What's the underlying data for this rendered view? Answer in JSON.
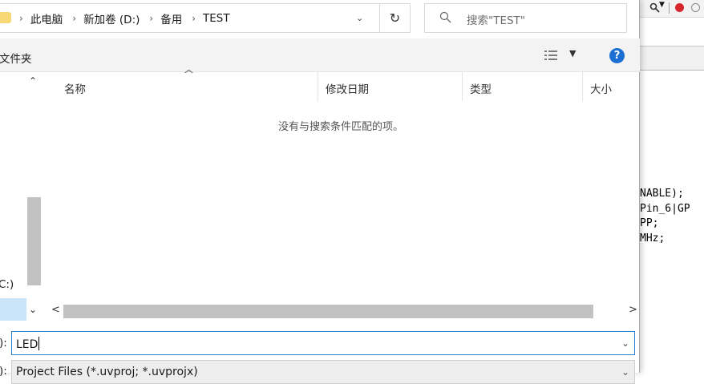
{
  "address_bar": {
    "separator": "›",
    "crumbs": [
      "此电脑",
      "新加卷 (D:)",
      "备用",
      "TEST"
    ],
    "dropdown_glyph": "⌄",
    "refresh_glyph": "↻"
  },
  "search": {
    "placeholder": "搜索\"TEST\"",
    "icon": "search-icon"
  },
  "command_bar": {
    "new_folder": "文件夹",
    "help_glyph": "?"
  },
  "nav_pane": {
    "visible_item": "C:)",
    "scroll_up": "⌃",
    "scroll_down": "⌄"
  },
  "file_list": {
    "sort_indicator": "^",
    "columns": [
      "名称",
      "修改日期",
      "类型",
      "大小"
    ],
    "empty_message": "没有与搜索条件匹配的项。",
    "scroll_left": "<",
    "scroll_right": ">"
  },
  "bottom": {
    "filename_label": "):",
    "filename_value": "LED",
    "filetype_label": "):",
    "filetype_value": "Project Files (*.uvproj; *.uvprojx)"
  },
  "background_app": {
    "code_lines": [
      "NABLE);",
      "Pin_6|GP",
      "PP;",
      "MHz;"
    ]
  },
  "colors": {
    "accent": "#1b6fd2",
    "selection": "#cce4f7",
    "folder": "#f8d775"
  }
}
